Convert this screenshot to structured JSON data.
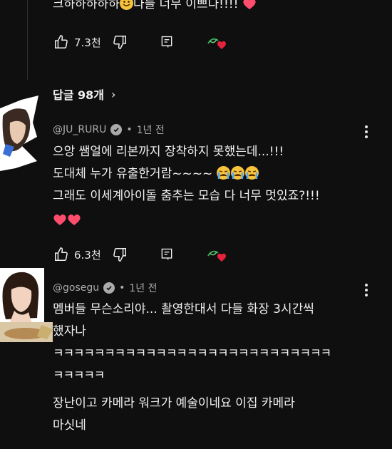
{
  "top_comment": {
    "text_before": "크하하하하하",
    "emoji": "smiling-face-emoji",
    "text_after": "다들 너무 이쁘다!!!! ",
    "likes": "7.3천"
  },
  "replies": {
    "label": "답글 98개",
    "chevron": "›"
  },
  "comments": [
    {
      "handle": "@JU_RURU",
      "time": "1년 전",
      "line1": "으앙 쌤얼에 리본까지 장착하지 못했는데...!!!",
      "line2": "도대체 누가 유출한거람~~~~ ",
      "line3": "그래도 이세계아이돌 춤추는 모습 다 너무 멋있죠?!!!",
      "likes": "6.3천"
    },
    {
      "handle": "@gosegu",
      "time": "1년 전",
      "line1": "멤버들  무슨소리야... 촬영한대서 다들 화장 3시간씩",
      "line2": "했자나",
      "line3": "ㅋㅋㅋㅋㅋㅋㅋㅋㅋㅋㅋㅋㅋㅋㅋㅋㅋㅋㅋㅋㅋㅋㅋㅋㅋㅋㅋ",
      "line4": "ㅋㅋㅋㅋㅋ",
      "line5": "장난이고 카메라 워크가 예술이네요 이집 카메라",
      "line6": "마싯네"
    }
  ],
  "icons": {
    "like": "thumbs-up-icon",
    "dislike": "thumbs-down-icon",
    "reply": "reply-icon",
    "heart": "heart-icon",
    "kebab": "more-vertical-icon"
  },
  "colors": {
    "heart": "#ff4d6d",
    "background": "#0f0f0f",
    "meta": "#aaaaaa"
  }
}
